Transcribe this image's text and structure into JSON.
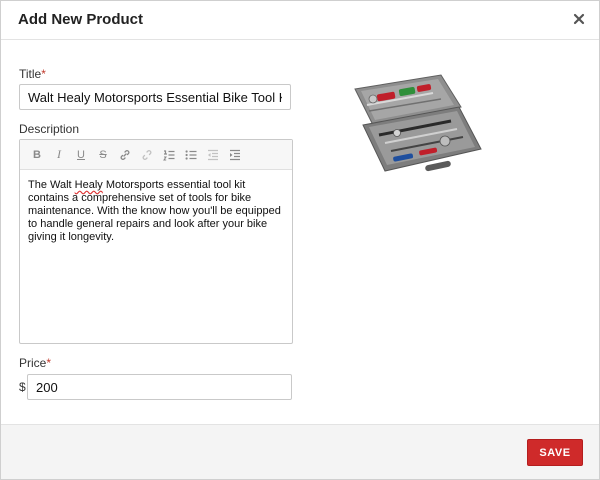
{
  "dialog": {
    "title": "Add New Product",
    "close_icon": "close-icon"
  },
  "form": {
    "title_label": "Title",
    "title_required": "*",
    "title_value": "Walt Healy Motorsports Essential Bike Tool Kit",
    "description_label": "Description",
    "description_text_before": "The Walt ",
    "description_text_misspelled": "Healy",
    "description_text_after": " Motorsports essential tool kit contains a comprehensive set of tools for bike maintenance. With the know how you'll be equipped to handle general repairs and look after your bike giving it longevity.",
    "price_label": "Price",
    "price_required": "*",
    "currency_symbol": "$",
    "price_value": "200"
  },
  "toolbar": {
    "buttons": [
      {
        "name": "bold-button",
        "glyph": "B"
      },
      {
        "name": "italic-button",
        "glyph": "I"
      },
      {
        "name": "underline-button",
        "glyph": "U"
      },
      {
        "name": "strikethrough-button",
        "glyph": "S"
      },
      {
        "name": "link-icon",
        "glyph": ""
      },
      {
        "name": "unlink-icon",
        "glyph": ""
      },
      {
        "name": "ordered-list-icon",
        "glyph": ""
      },
      {
        "name": "unordered-list-icon",
        "glyph": ""
      },
      {
        "name": "outdent-icon",
        "glyph": ""
      },
      {
        "name": "indent-icon",
        "glyph": ""
      }
    ]
  },
  "footer": {
    "save_label": "SAVE"
  },
  "colors": {
    "accent": "#cf2a2a",
    "required": "#c0392b"
  }
}
